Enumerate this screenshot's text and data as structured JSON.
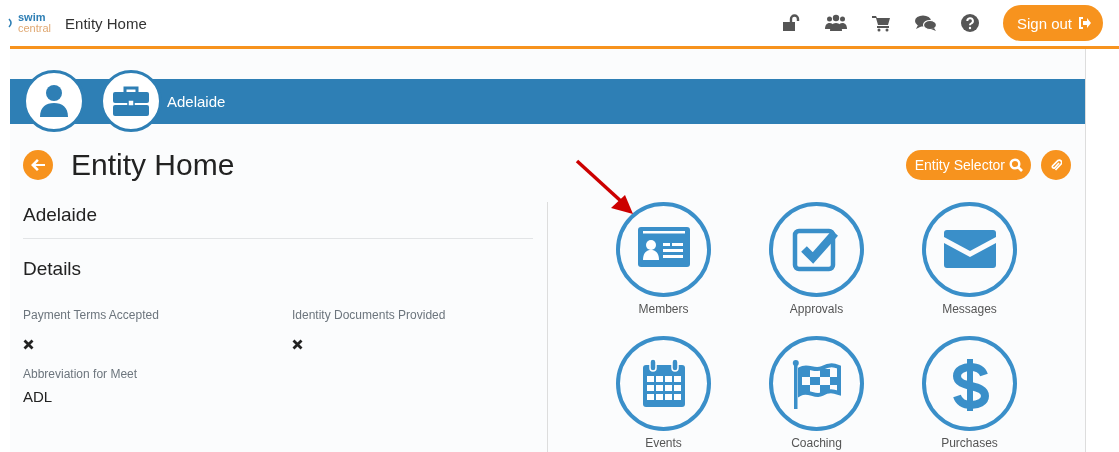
{
  "header": {
    "logo": {
      "line1": "swim",
      "line2": "central"
    },
    "title": "Entity Home",
    "toolbar_icons": [
      {
        "kind": "unlock"
      },
      {
        "kind": "users"
      },
      {
        "kind": "cart"
      },
      {
        "kind": "chat"
      },
      {
        "kind": "help"
      }
    ],
    "sign_out": "Sign out"
  },
  "banner": {
    "entity": "Adelaide"
  },
  "page_title": "Entity Home",
  "entity_selector": "Entity Selector",
  "details": {
    "entity_name": "Adelaide",
    "heading": "Details",
    "fields": [
      {
        "kind": "flag",
        "label": "Payment Terms Accepted",
        "value": false
      },
      {
        "kind": "flag",
        "label": "Identity Documents Provided",
        "value": false
      },
      {
        "kind": "text",
        "label": "Abbreviation for Meet",
        "value": "ADL"
      }
    ]
  },
  "tiles": [
    {
      "kind": "members",
      "label": "Members"
    },
    {
      "kind": "approvals",
      "label": "Approvals"
    },
    {
      "kind": "messages",
      "label": "Messages"
    },
    {
      "kind": "events",
      "label": "Events"
    },
    {
      "kind": "coaching",
      "label": "Coaching"
    },
    {
      "kind": "purchases",
      "label": "Purchases"
    }
  ]
}
